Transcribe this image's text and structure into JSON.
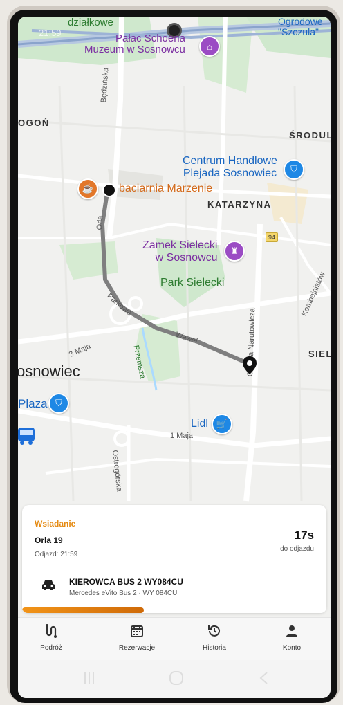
{
  "status_bar": {
    "time": "21:59"
  },
  "map": {
    "area_labels": [
      "OGOŃ",
      "ŚRODUL",
      "KATARZYNA",
      "SIEL"
    ],
    "city_label": "osnowiec",
    "pois": {
      "palace": "Pałac Schoena\nMuzeum w Sosnowcu",
      "centrum": "Centrum Handlowe\nPlejada Sosnowiec",
      "kawiarnia": "baciarnia Marzenie",
      "zamek": "Zamek Sielecki\nw Sosnowcu",
      "park": "Park Sielecki",
      "plaza": "Plaza",
      "lidl": "Lidl",
      "dzialkowe": "działkowe",
      "ogrodowe": "Ogrodowe\n\"Szczula\""
    },
    "streets": {
      "bedzinska": "Będzińska",
      "orla": "Orla",
      "parkowa": "Parkowa",
      "wawel": "Wawel",
      "przemsza": "Przemsza",
      "narutowicza": "Gen. la Narutowicza",
      "kombajnistow": "Kombajnistów",
      "trzeci_maja": "3 Maja",
      "pierwszy_maja": "1 Maja",
      "ostrogorska": "Ostrogórska"
    },
    "route_badge": "94"
  },
  "card": {
    "status": "Wsiadanie",
    "stop": "Orla 19",
    "departure": "Odjazd: 21:59",
    "countdown": "17s",
    "countdown_label": "do odjazdu",
    "driver": "KIEROWCA BUS 2 WY084CU",
    "vehicle": "Mercedes eVito Bus 2 · WY 084CU",
    "progress": 0.4
  },
  "bottom_nav": [
    {
      "label": "Podróż",
      "icon": "route-icon"
    },
    {
      "label": "Rezerwacje",
      "icon": "calendar-icon"
    },
    {
      "label": "Historia",
      "icon": "history-icon"
    },
    {
      "label": "Konto",
      "icon": "person-icon"
    }
  ],
  "colors": {
    "accent": "#e58a12",
    "route": "#7f7f7f",
    "poi_purple": "#9b4cc4",
    "poi_blue": "#1e88e5"
  }
}
